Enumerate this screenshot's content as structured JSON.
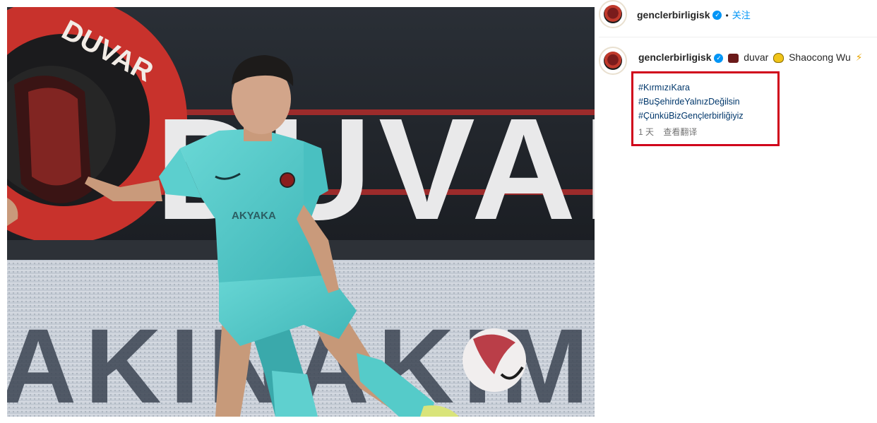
{
  "post": {
    "username": "genclerbirligisk",
    "follow_label": "关注",
    "caption_mention_1": "duvar",
    "caption_mention_2": "Shaocong Wu",
    "hashtags": [
      "#KırmızıKara",
      "#BuŞehirdeYalnızDeğilsin",
      "#ÇünküBizGençlerbirliğiyiz"
    ],
    "time_ago": "1 天",
    "translate_label": "查看翻译"
  },
  "photo": {
    "banner_brand": "DUVAR",
    "ring_text": "DUVAR",
    "board_text": "AKINAKIM",
    "sponsor_text": "AKYAKA"
  },
  "icons": {
    "verified": "verified-badge-icon",
    "cap_emoji": "graduation-cap-emoji-icon",
    "heart_emoji": "yellow-heart-emoji-icon",
    "bolt_emoji": "lightning-emoji-icon"
  },
  "colors": {
    "accent": "#0095f6",
    "hashtag": "#00376b",
    "highlight_box": "#d0021b",
    "kit": "#4fc9c9"
  }
}
